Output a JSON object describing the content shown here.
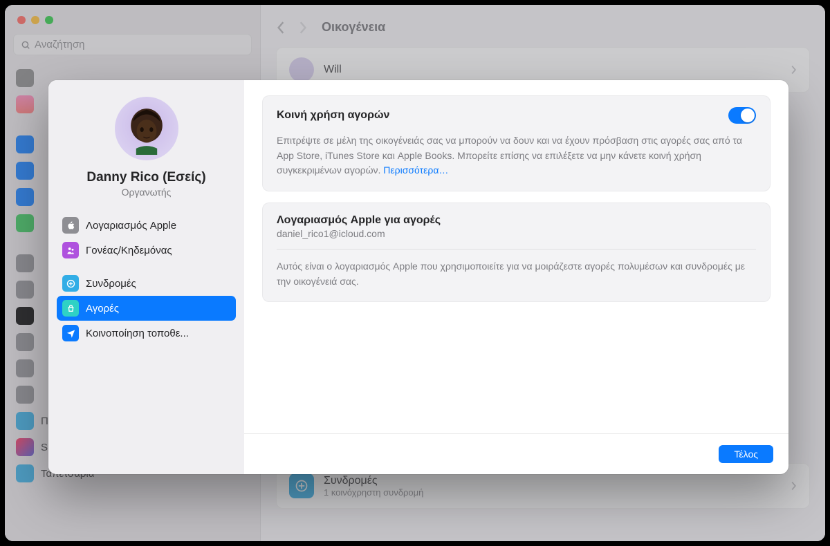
{
  "bg": {
    "search_placeholder": "Αναζήτηση",
    "title": "Οικογένεια",
    "sidebar_items": [
      {
        "label": "Προφύλαξη οθόνης"
      },
      {
        "label": "Siri"
      },
      {
        "label": "Ταπετσαρία"
      }
    ],
    "member_name": "Will",
    "subscriptions": {
      "title": "Συνδρομές",
      "subtitle": "1 κοινόχρηστη συνδρομή"
    }
  },
  "modal": {
    "user": {
      "name": "Danny Rico (Εσείς)",
      "role": "Οργανωτής"
    },
    "nav": {
      "apple_account": "Λογαριασμός Apple",
      "parent": "Γονέας/Κηδεμόνας",
      "subscriptions": "Συνδρομές",
      "purchases": "Αγορές",
      "location": "Κοινοποίηση τοποθε..."
    },
    "purchase_sharing": {
      "title": "Κοινή χρήση αγορών",
      "description": "Επιτρέψτε σε μέλη της οικογένειάς σας να μπορούν να δουν και να έχουν πρόσβαση στις αγορές σας από τα App Store, iTunes Store και Apple Books. Μπορείτε επίσης να επιλέξετε να μην κάνετε κοινή χρήση συγκεκριμένων αγορών. ",
      "more": "Περισσότερα…"
    },
    "account": {
      "title": "Λογαριασμός Apple για αγορές",
      "email": "daniel_rico1@icloud.com",
      "description": "Αυτός είναι ο λογαριασμός Apple που χρησιμοποιείτε για να μοιράζεστε αγορές πολυμέσων και συνδρομές με την οικογένειά σας."
    },
    "done": "Τέλος"
  },
  "colors": {
    "blue": "#0a7aff",
    "grey_icon": "#8e8e93",
    "purple": "#af52de",
    "teal": "#2fd1c5",
    "cyan": "#32ade6",
    "nav_blue": "#007aff"
  }
}
